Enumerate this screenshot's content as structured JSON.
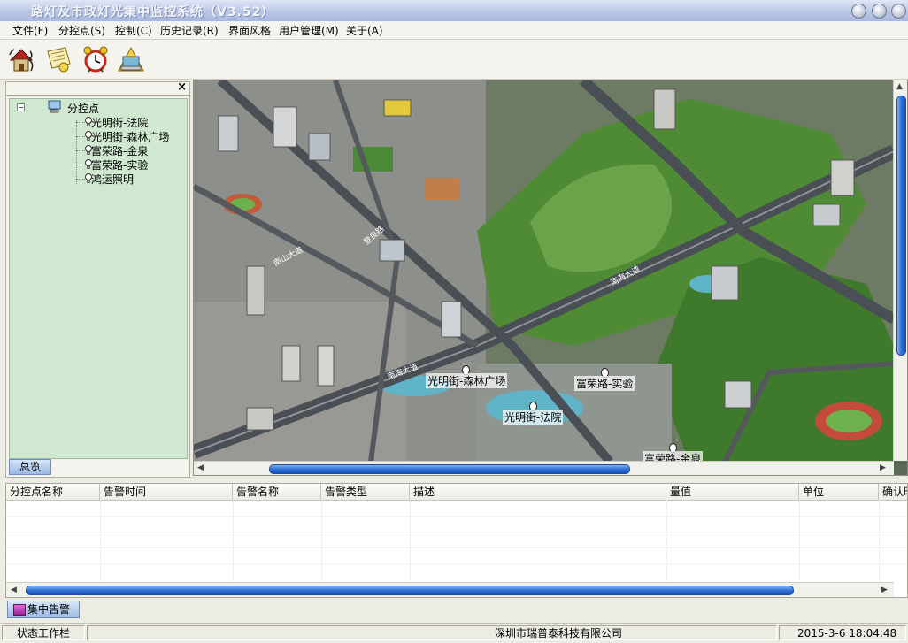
{
  "window": {
    "title": "路灯及市政灯光集中监控系统（V3.52）"
  },
  "menu": [
    {
      "label": "文件(F)"
    },
    {
      "label": "分控点(S)"
    },
    {
      "label": "控制(C)"
    },
    {
      "label": "历史记录(R)"
    },
    {
      "label": "界面风格"
    },
    {
      "label": "用户管理(M)"
    },
    {
      "label": "关于(A)"
    }
  ],
  "toolbar": {
    "icons": [
      "house-icon",
      "scroll-icon",
      "alarm-clock-icon",
      "computer-icon"
    ]
  },
  "tree": {
    "root": "分控点",
    "children": [
      "光明街-法院",
      "光明街-森林广场",
      "富荣路-金泉",
      "富荣路-实验",
      "鸿运照明"
    ],
    "close": "×",
    "expander": "−"
  },
  "overview_tab": "总览",
  "map": {
    "pins": [
      {
        "label": "光明街-森林广场"
      },
      {
        "label": "富荣路-实验"
      },
      {
        "label": "光明街-法院"
      },
      {
        "label": "富荣路-金泉"
      }
    ],
    "road_labels": [
      "南海大道",
      "南海大道",
      "南山大道",
      "登良路"
    ]
  },
  "alarm_table": {
    "columns": [
      "分控点名称",
      "告警时间",
      "告警名称",
      "告警类型",
      "描述",
      "量值",
      "单位",
      "确认时"
    ]
  },
  "alarm_tab": "集中告警",
  "status": {
    "left": "状态工作栏",
    "company": "深圳市瑞普泰科技有限公司",
    "datetime": "2015-3-6  18:04:48"
  }
}
